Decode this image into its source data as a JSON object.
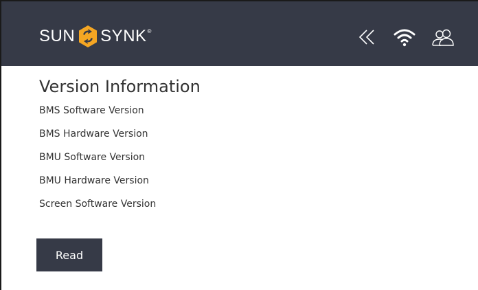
{
  "header": {
    "brand_left": "SUN",
    "brand_right": "SYNK",
    "brand_mark": "®",
    "icons": {
      "back": "double-chevron-left-icon",
      "wifi": "wifi-icon",
      "user": "users-icon"
    },
    "colors": {
      "background": "#363a47",
      "logo_accent": "#f5a623"
    }
  },
  "main": {
    "title": "Version Information",
    "versions": [
      "BMS Software Version",
      "BMS Hardware Version",
      "BMU Software Version",
      "BMU Hardware Version",
      "Screen Software Version"
    ],
    "read_label": "Read"
  }
}
